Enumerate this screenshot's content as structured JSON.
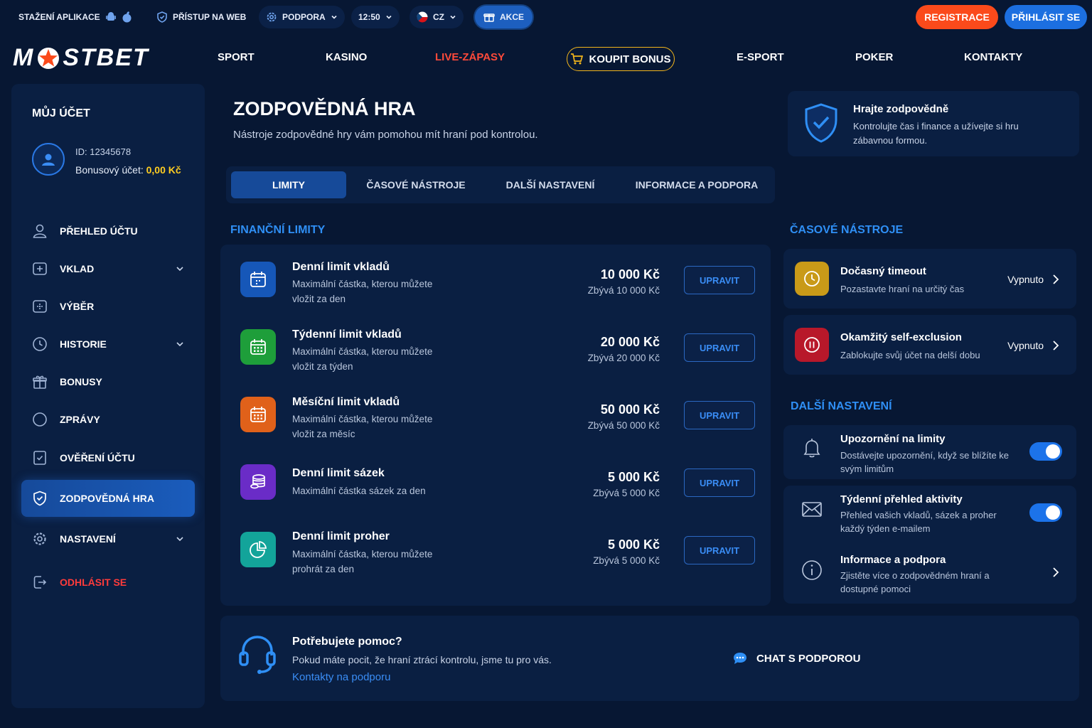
{
  "topbar": {
    "app_download": "STAŽENÍ APLIKACE",
    "web_access": "PŘÍSTUP NA WEB",
    "support": "PODPORA",
    "time": "12:50",
    "language": "CZ",
    "promo": "AKCE",
    "register": "REGISTRACE",
    "login": "PŘIHLÁSIT SE"
  },
  "brand": {
    "logo_left": "M",
    "logo_right": "STBET"
  },
  "nav": {
    "sport": "SPORT",
    "casino": "KASINO",
    "live": "LIVE-ZÁPASY",
    "buy_bonus": "KOUPIT BONUS",
    "esport": "E-SPORT",
    "poker": "POKER",
    "contacts": "KONTAKTY"
  },
  "sidebar": {
    "title": "MŮJ ÚČET",
    "account_id": "ID: 12345678",
    "bonus_label": "Bonusový účet:",
    "bonus_amount": "0,00 Kč",
    "items": [
      {
        "label": "PŘEHLED ÚČTU"
      },
      {
        "label": "VKLAD"
      },
      {
        "label": "VÝBĚR"
      },
      {
        "label": "HISTORIE"
      },
      {
        "label": "BONUSY"
      },
      {
        "label": "ZPRÁVY"
      },
      {
        "label": "OVĚŘENÍ ÚČTU"
      },
      {
        "label": "ZODPOVĚDNÁ HRA"
      },
      {
        "label": "NASTAVENÍ"
      }
    ],
    "logout": "ODHLÁSIT SE"
  },
  "page": {
    "title": "ZODPOVĚDNÁ HRA",
    "subtitle": "Nástroje zodpovědné hry vám pomohou mít hraní pod kontrolou."
  },
  "info_card": {
    "title": "Hrajte zodpovědně",
    "text": "Kontrolujte čas i finance a užívejte si hru zábavnou formou."
  },
  "tabs": [
    {
      "label": "LIMITY"
    },
    {
      "label": "ČASOVÉ NÁSTROJE"
    },
    {
      "label": "DALŠÍ NASTAVENÍ"
    },
    {
      "label": "INFORMACE A PODPORA"
    }
  ],
  "financial": {
    "title": "FINANČNÍ LIMITY",
    "edit_label": "UPRAVIT",
    "limits": [
      {
        "title": "Denní limit vkladů",
        "desc": "Maximální částka, kterou můžete vložit za den",
        "amount": "10 000 Kč",
        "remaining": "Zbývá 10 000 Kč"
      },
      {
        "title": "Týdenní limit vkladů",
        "desc": "Maximální částka, kterou můžete vložit za týden",
        "amount": "20 000 Kč",
        "remaining": "Zbývá 20 000 Kč"
      },
      {
        "title": "Měsíční limit vkladů",
        "desc": "Maximální částka, kterou můžete vložit za měsíc",
        "amount": "50 000 Kč",
        "remaining": "Zbývá 50 000 Kč"
      },
      {
        "title": "Denní limit sázek",
        "desc": "Maximální částka sázek za den",
        "amount": "5 000 Kč",
        "remaining": "Zbývá 5 000 Kč"
      },
      {
        "title": "Denní limit proher",
        "desc": "Maximální částka, kterou můžete prohrát za den",
        "amount": "5 000 Kč",
        "remaining": "Zbývá 5 000 Kč"
      }
    ]
  },
  "time_tools": {
    "title": "ČASOVÉ NÁSTROJE",
    "items": [
      {
        "title": "Dočasný timeout",
        "desc": "Pozastavte hraní na určitý čas",
        "state": "Vypnuto"
      },
      {
        "title": "Okamžitý self-exclusion",
        "desc": "Zablokujte svůj účet na delší dobu",
        "state": "Vypnuto"
      }
    ]
  },
  "other_settings": {
    "title": "DALŠÍ NASTAVENÍ",
    "items": [
      {
        "title": "Upozornění na limity",
        "desc": "Dostávejte upozornění, když se blížíte ke svým limitům",
        "enabled": true
      },
      {
        "title": "Týdenní přehled aktivity",
        "desc": "Přehled vašich vkladů, sázek a proher každý týden e-mailem",
        "enabled": true
      },
      {
        "title": "Informace a podpora",
        "desc": "Zjistěte více o zodpovědném hraní a dostupné pomoci"
      }
    ]
  },
  "help": {
    "title": "Potřebujete pomoc?",
    "text": "Pokud máte pocit, že hraní ztrácí kontrolu, jsme tu pro vás.",
    "link": "Kontakty na podporu",
    "chat": "CHAT S PODPOROU"
  },
  "colors": {
    "background": "#071733",
    "panel": "#0a1f42",
    "accent_blue": "#2f8ff5",
    "register": "#fb4a1b",
    "live": "#ff4a3a",
    "bonus_gold": "#ffcd21"
  }
}
